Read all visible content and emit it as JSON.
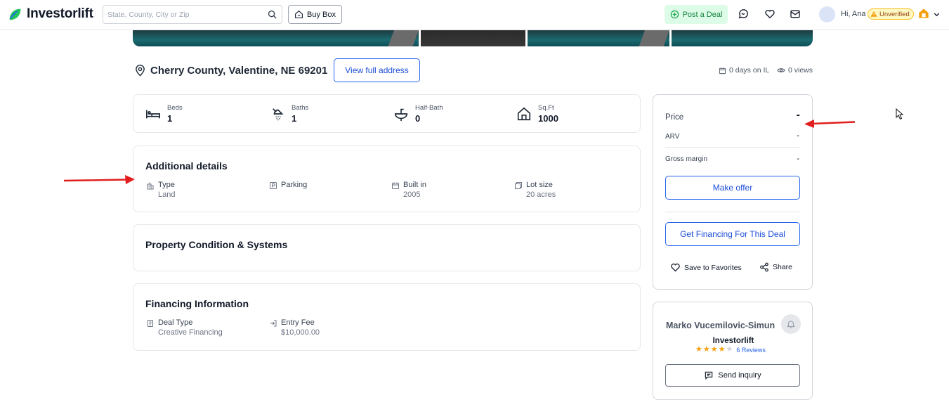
{
  "nav": {
    "brand": "Investorlift",
    "search_placeholder": "State, County, City or Zip",
    "buy_box": "Buy Box",
    "post_deal": "Post a Deal",
    "greeting": "Hi, Ana",
    "status_badge": "Unverified",
    "accent_color": "#16a34a"
  },
  "property": {
    "address": "Cherry County, Valentine, NE 69201",
    "view_full_address": "View full address",
    "days_on": "0 days on IL",
    "views": "0 views"
  },
  "stats": [
    {
      "icon": "bed-icon",
      "label": "Beds",
      "value": "1"
    },
    {
      "icon": "shower-icon",
      "label": "Baths",
      "value": "1"
    },
    {
      "icon": "sink-icon",
      "label": "Half-Bath",
      "value": "0"
    },
    {
      "icon": "house-icon",
      "label": "Sq.Ft",
      "value": "1000"
    }
  ],
  "additional": {
    "title": "Additional details",
    "items": [
      {
        "icon": "building-icon",
        "label": "Type",
        "value": "Land"
      },
      {
        "icon": "parking-icon",
        "label": "Parking",
        "value": ""
      },
      {
        "icon": "calendar-icon",
        "label": "Built in",
        "value": "2005"
      },
      {
        "icon": "lot-icon",
        "label": "Lot size",
        "value": "20 acres"
      }
    ]
  },
  "condition": {
    "title": "Property Condition & Systems"
  },
  "financing": {
    "title": "Financing Information",
    "items": [
      {
        "icon": "document-icon",
        "label": "Deal Type",
        "value": "Creative Financing"
      },
      {
        "icon": "entry-icon",
        "label": "Entry Fee",
        "value": "$10,000.00"
      }
    ]
  },
  "pricing": {
    "price_label": "Price",
    "price_value": "-",
    "arv_label": "ARV",
    "arv_value": "-",
    "gross_margin_label": "Gross margin",
    "gross_margin_value": "-",
    "make_offer": "Make offer",
    "get_financing": "Get Financing For This Deal",
    "save_favorites": "Save to Favorites",
    "share": "Share"
  },
  "agent": {
    "name": "Marko Vucemilovic-Simun",
    "company": "Investorlift",
    "rating": 4,
    "reviews": "6 Reviews",
    "send_inquiry": "Send inquiry"
  },
  "annotations": {
    "arrow_color": "#e11d1d"
  }
}
